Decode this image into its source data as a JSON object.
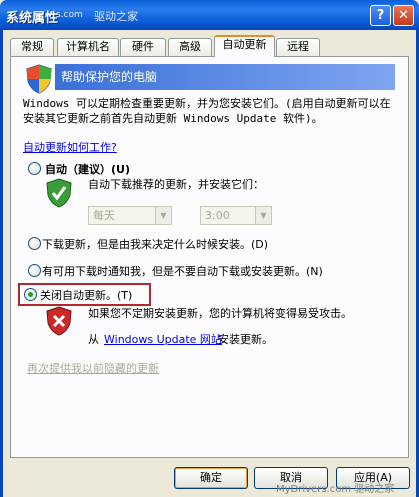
{
  "window": {
    "title": "系统属性",
    "watermark_small": "s.com",
    "watermark_brand": "驱动之家",
    "help_button": "?",
    "close_button": "✕"
  },
  "tabs": [
    {
      "label": "常规"
    },
    {
      "label": "计算机名"
    },
    {
      "label": "硬件"
    },
    {
      "label": "高级"
    },
    {
      "label": "自动更新"
    },
    {
      "label": "远程"
    }
  ],
  "active_tab": "自动更新",
  "header": {
    "text": "帮助保护您的电脑"
  },
  "description": "Windows 可以定期检查重要更新，并为您安装它们。(启用自动更新可以在安装其它更新之前首先自动更新 Windows Update 软件)。",
  "how_link": "自动更新如何工作?",
  "options": [
    {
      "label": "自动（建议）(U)",
      "checked": false
    },
    {
      "label": "下载更新，但是由我来决定什么时候安装。(D)",
      "checked": false
    },
    {
      "label": "有可用下载时通知我，但是不要自动下载或安装更新。(N)",
      "checked": false
    },
    {
      "label": "关闭自动更新。(T)",
      "checked": true
    }
  ],
  "auto_sub": "自动下载推荐的更新，并安装它们：",
  "schedule": {
    "day": "每天",
    "time": "3:00"
  },
  "off_warning": "如果您不定期安装更新，您的计算机将变得易受攻击。",
  "from_prefix": "从",
  "windows_update_link": "Windows Update 网站",
  "from_suffix": "安装更新。",
  "hidden_updates_link": "再次提供我以前隐藏的更新",
  "buttons": {
    "ok": "确定",
    "cancel": "取消",
    "apply": "应用(A)"
  },
  "footer_watermark": "MyDrivers.com 驱动之家",
  "colors": {
    "titlebar": "#0a5fd8",
    "highlight": "#b3282d",
    "radio_dot": "#21a121"
  }
}
